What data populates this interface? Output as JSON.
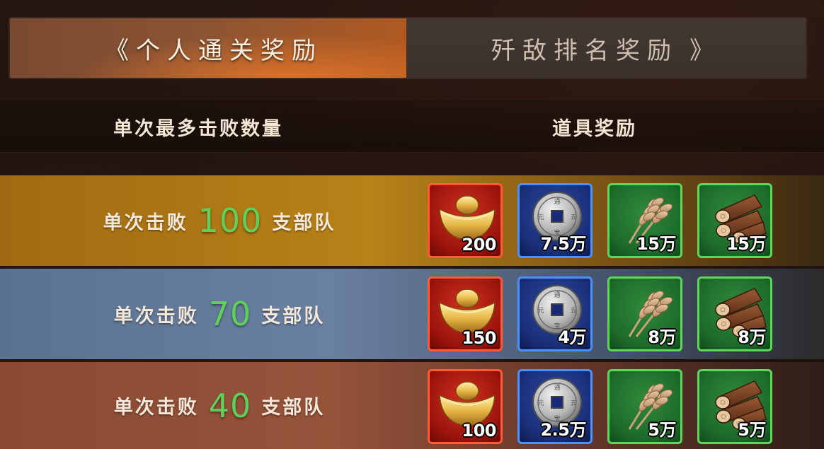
{
  "tabs": {
    "left_arrow": "《",
    "active": "个人通关奖励",
    "inactive": "歼敌排名奖励",
    "right_arrow": "》"
  },
  "header": {
    "left": "单次最多击败数量",
    "right": "道具奖励"
  },
  "rows": [
    {
      "prefix": "单次击败",
      "count": "100",
      "suffix": "支部队",
      "items": [
        {
          "icon": "gold-ingot-icon",
          "qty": "200"
        },
        {
          "icon": "copper-coin-icon",
          "qty": "7.5万"
        },
        {
          "icon": "wheat-icon",
          "qty": "15万"
        },
        {
          "icon": "wood-logs-icon",
          "qty": "15万"
        }
      ]
    },
    {
      "prefix": "单次击败",
      "count": "70",
      "suffix": "支部队",
      "items": [
        {
          "icon": "gold-ingot-icon",
          "qty": "150"
        },
        {
          "icon": "copper-coin-icon",
          "qty": "4万"
        },
        {
          "icon": "wheat-icon",
          "qty": "8万"
        },
        {
          "icon": "wood-logs-icon",
          "qty": "8万"
        }
      ]
    },
    {
      "prefix": "单次击败",
      "count": "40",
      "suffix": "支部队",
      "items": [
        {
          "icon": "gold-ingot-icon",
          "qty": "100"
        },
        {
          "icon": "copper-coin-icon",
          "qty": "2.5万"
        },
        {
          "icon": "wheat-icon",
          "qty": "5万"
        },
        {
          "icon": "wood-logs-icon",
          "qty": "5万"
        }
      ]
    }
  ],
  "colors": {
    "count_green": "#5fd05a",
    "tab_active_orange": "#b05a22",
    "slot_red_border": "#ff5a32",
    "slot_blue_border": "#4a92ff",
    "slot_green_border": "#5ed85a"
  }
}
